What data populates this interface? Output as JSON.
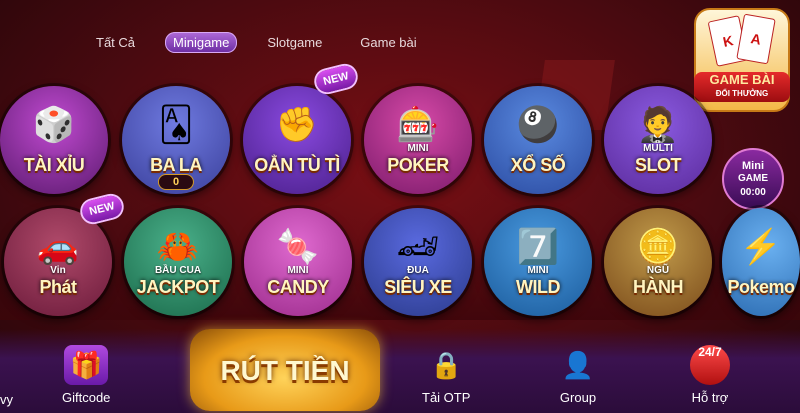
{
  "tabs": [
    {
      "label": "Tất Cả",
      "active": false
    },
    {
      "label": "Minigame",
      "active": true
    },
    {
      "label": "Slotgame",
      "active": false
    },
    {
      "label": "Game bài",
      "active": false
    }
  ],
  "logo": {
    "title": "GAME BÀI",
    "subtitle": "ĐỔI THƯỞNG",
    "card_letters": [
      "K",
      "A"
    ]
  },
  "games_row1": [
    {
      "name": "TÀI XỈU",
      "art": "🎲",
      "bg": "#5b1a6e"
    },
    {
      "name": "BA LA",
      "art": "🂡",
      "bg": "#3a3f9a",
      "jackpot": "0"
    },
    {
      "name": "OẲN TÙ TÌ",
      "art": "✊",
      "bg": "#4a1f8a",
      "badge": "NEW"
    },
    {
      "name": "POKER",
      "sub": "MINI",
      "art": "🎰",
      "bg": "#7a1a6a"
    },
    {
      "name": "XỔ SỐ",
      "art": "🎱",
      "bg": "#2a4aa0"
    },
    {
      "name": "SLOT",
      "sub": "MULTI",
      "art": "🤵",
      "bg": "#5a2a9a"
    }
  ],
  "games_row2": [
    {
      "name": "Phát",
      "sub": "Vin",
      "art": "🚗",
      "bg": "#6a1a3a",
      "badge": "NEW"
    },
    {
      "name": "JACKPOT",
      "sub": "BẦU CUA",
      "art": "🦀",
      "bg": "#1a6a4a"
    },
    {
      "name": "CANDY",
      "sub": "MINI",
      "art": "🍬",
      "bg": "#9a2a8a"
    },
    {
      "name": "SIÊU XE",
      "sub": "ĐUA",
      "art": "🏎",
      "bg": "#2a3a8a"
    },
    {
      "name": "WILD",
      "sub": "MINI",
      "art": "7️⃣",
      "bg": "#1a5a9a"
    },
    {
      "name": "HÀNH",
      "sub": "NGŨ",
      "art": "🪙",
      "bg": "#7a4a1a"
    },
    {
      "name": "Pokemo",
      "art": "⚡",
      "bg": "#2a6ab0"
    }
  ],
  "mini_timer": {
    "line1": "Mini",
    "line2": "GAME",
    "time": "00:00"
  },
  "bottom_nav": {
    "left_cut": "vy",
    "giftcode": "Giftcode",
    "withdraw": "RÚT TIỀN",
    "otp": "Tải OTP",
    "group": "Group",
    "support": "Hỗ trợ",
    "support_badge": "24/7"
  },
  "colors": {
    "accent": "#b06bd9",
    "background": "#4a0a10",
    "gold": "#e89a18"
  }
}
